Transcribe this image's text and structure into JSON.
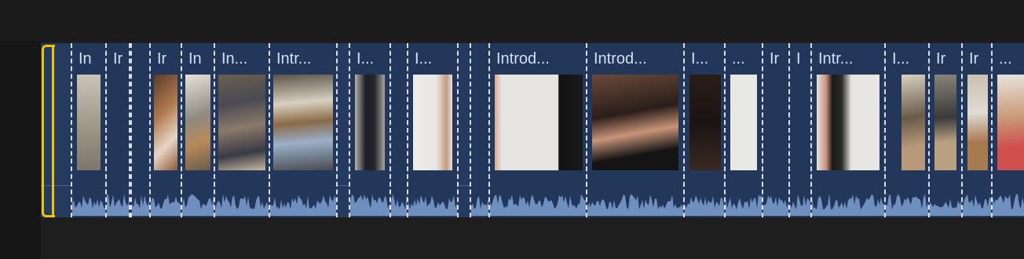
{
  "timeline": {
    "clip_titles": [
      "In",
      "Ir",
      "",
      "Ir",
      "In",
      "In...",
      "Intr...",
      "I...",
      "",
      "I...",
      "",
      "Introd...",
      "Introd...",
      "I...",
      "...",
      "Ir",
      "I",
      "Intr...",
      "I...",
      "Ir",
      "Ir",
      "..."
    ],
    "accent_color": "#f2c100",
    "clip_color": "#22375a"
  }
}
